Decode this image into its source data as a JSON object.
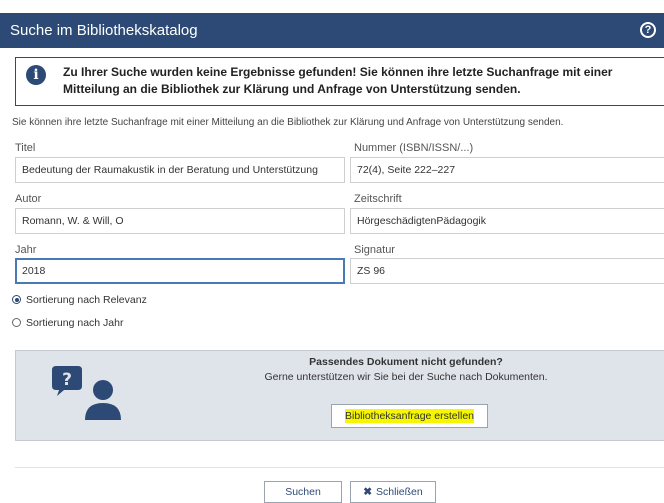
{
  "header": {
    "title": "Suche im Bibliothekskatalog",
    "help_icon": "?"
  },
  "alert": {
    "icon": "i",
    "message": "Zu Ihrer Suche wurden keine Ergebnisse gefunden! Sie können ihre letzte Suchanfrage mit einer Mitteilung an die Bibliothek zur Klärung und Anfrage von Unterstützung senden."
  },
  "hint": "Sie können ihre letzte Suchanfrage mit einer Mitteilung an die Bibliothek zur Klärung und Anfrage von Unterstützung senden.",
  "form": {
    "title_label": "Titel",
    "title_value": "Bedeutung der Raumakustik in der Beratung und Unterstützung",
    "number_label": "Nummer (ISBN/ISSN/...)",
    "number_value": "72(4),  Seite 222–227",
    "author_label": "Autor",
    "author_value": "Romann, W. & Will, O",
    "journal_label": "Zeitschrift",
    "journal_value": "HörgeschädigtenPädagogik",
    "year_label": "Jahr",
    "year_value": "2018",
    "signature_label": "Signatur",
    "signature_value": "ZS 96"
  },
  "sorting": {
    "option_relevance": "Sortierung nach Relevanz",
    "option_year": "Sortierung nach Jahr",
    "selected": "relevance"
  },
  "panel": {
    "title": "Passendes Dokument nicht gefunden?",
    "subtitle": "Gerne unterstützen wir Sie bei der Suche nach Dokumenten.",
    "button_label": "Bibliotheksanfrage erstellen"
  },
  "footer": {
    "search_label": "Suchen",
    "close_label": "Schließen"
  },
  "icons": {
    "help": "help-icon",
    "info": "info-icon",
    "support": "person-question-icon",
    "close": "close-icon"
  },
  "colors": {
    "header_bg": "#2c4a75",
    "panel_bg": "#dfe3ea",
    "highlight": "#f6f600"
  }
}
